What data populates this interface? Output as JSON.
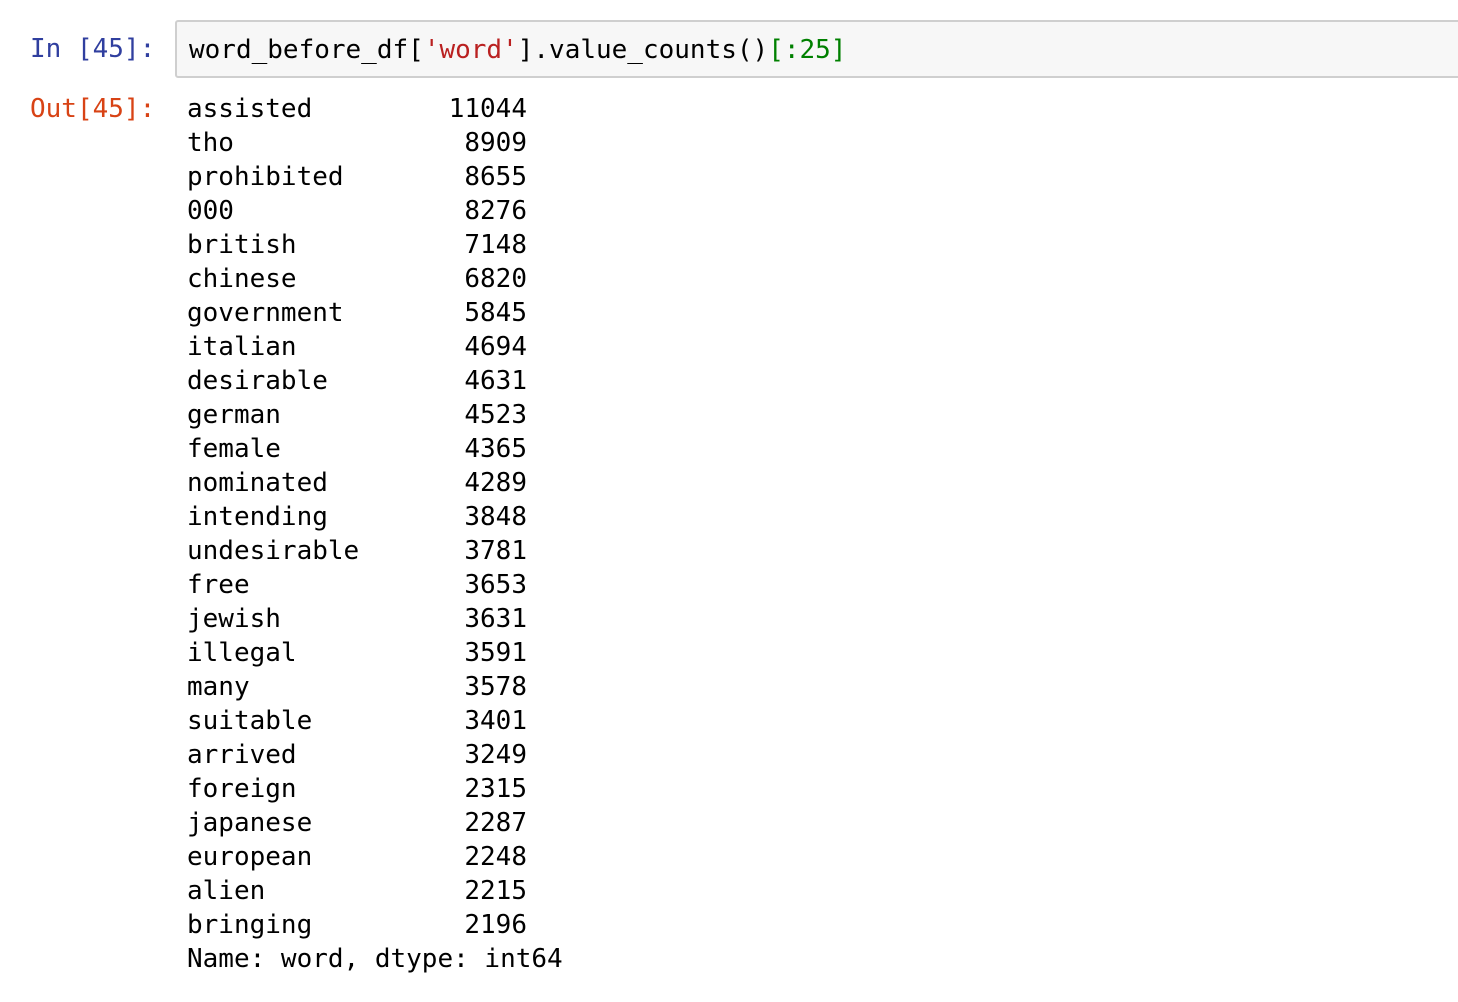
{
  "prompts": {
    "input": "In [45]:",
    "output": "Out[45]:"
  },
  "input": {
    "code_parts": [
      "word_before_df[",
      "'word'",
      "].value_counts()",
      "[:25]"
    ]
  },
  "output": {
    "rows": [
      {
        "word": "assisted",
        "count": "11044"
      },
      {
        "word": "tho",
        "count": "8909"
      },
      {
        "word": "prohibited",
        "count": "8655"
      },
      {
        "word": "000",
        "count": "8276"
      },
      {
        "word": "british",
        "count": "7148"
      },
      {
        "word": "chinese",
        "count": "6820"
      },
      {
        "word": "government",
        "count": "5845"
      },
      {
        "word": "italian",
        "count": "4694"
      },
      {
        "word": "desirable",
        "count": "4631"
      },
      {
        "word": "german",
        "count": "4523"
      },
      {
        "word": "female",
        "count": "4365"
      },
      {
        "word": "nominated",
        "count": "4289"
      },
      {
        "word": "intending",
        "count": "3848"
      },
      {
        "word": "undesirable",
        "count": "3781"
      },
      {
        "word": "free",
        "count": "3653"
      },
      {
        "word": "jewish",
        "count": "3631"
      },
      {
        "word": "illegal",
        "count": "3591"
      },
      {
        "word": "many",
        "count": "3578"
      },
      {
        "word": "suitable",
        "count": "3401"
      },
      {
        "word": "arrived",
        "count": "3249"
      },
      {
        "word": "foreign",
        "count": "2315"
      },
      {
        "word": "japanese",
        "count": "2287"
      },
      {
        "word": "european",
        "count": "2248"
      },
      {
        "word": "alien",
        "count": "2215"
      },
      {
        "word": "bringing",
        "count": "2196"
      }
    ],
    "footer": "Name: word, dtype: int64"
  }
}
